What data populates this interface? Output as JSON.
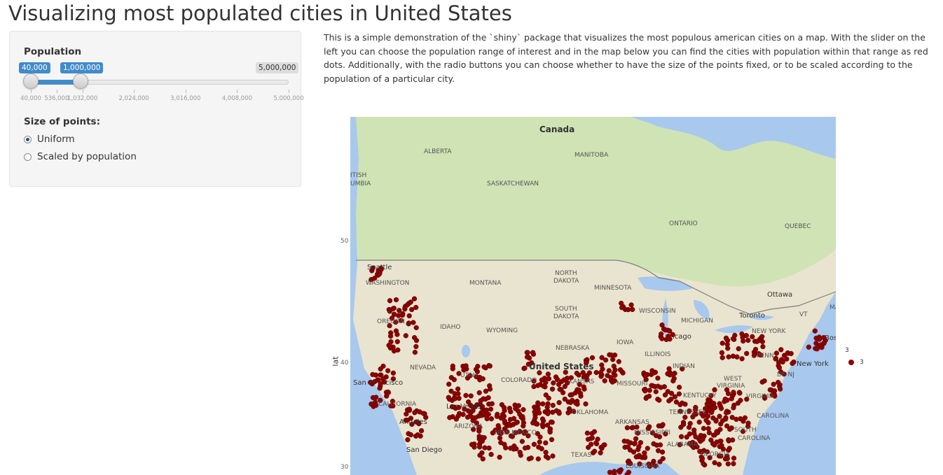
{
  "page": {
    "title": "Visualizing most populated cities in United States"
  },
  "sidebar": {
    "population_label": "Population",
    "slider": {
      "min_badge": "40,000",
      "high_badge": "1,000,000",
      "max_badge": "5,000,000",
      "selected_low": 40000,
      "selected_high": 1000000,
      "range_min": 40000,
      "range_max": 5000000,
      "ticks": [
        "40,000",
        "536,000",
        "1,032,000",
        "2,024,000",
        "3,016,000",
        "4,008,000",
        "5,000,000"
      ],
      "tick_values": [
        40000,
        536000,
        1032000,
        2024000,
        3016000,
        4008000,
        5000000
      ]
    },
    "size_label": "Size of points:",
    "radios": [
      {
        "label": "Uniform",
        "checked": true
      },
      {
        "label": "Scaled by population",
        "checked": false
      }
    ]
  },
  "description": "This is a simple demonstration of the `shiny` package that visualizes the most populous american cities on a map. With the slider on the left you can choose the population range of interest and in the map below you can find the cities with population within that range as red dots. Additionally, with the radio buttons you can choose whether to have the size of the points fixed, or to be scaled according to the population of a particular city.",
  "plot": {
    "y_axis_title": "lat",
    "y_ticks": [
      "50",
      "40",
      "30"
    ],
    "legend_title": "3",
    "legend_label": "3",
    "point_color": "#8b0000",
    "map_labels": {
      "canada": "Canada",
      "alberta": "ALBERTA",
      "manitoba": "MANITOBA",
      "british_columbia_1": "ITISH",
      "british_columbia_2": "UMBIA",
      "saskatchewan": "SASKATCHEWAN",
      "ontario": "ONTARIO",
      "quebec": "QUEBEC",
      "seattle": "Seattle",
      "washington": "WASHINGTON",
      "montana": "MONTANA",
      "north_dakota_1": "NORTH",
      "north_dakota_2": "DAKOTA",
      "minnesota": "MINNESOTA",
      "ottawa": "Ottawa",
      "south_dakota_1": "SOUTH",
      "south_dakota_2": "DAKOTA",
      "wisconsin": "WISCONSIN",
      "toronto": "Toronto",
      "oregon": "OREGON",
      "idaho": "IDAHO",
      "wyoming": "WYOMING",
      "michigan": "MICHIGAN",
      "new_york_state": "NEW YORK",
      "vt": "VT",
      "ma": "MA",
      "chicago": "icago",
      "iowa": "IOWA",
      "nebraska": "NEBRASKA",
      "boston": "Bos",
      "illinois": "ILLINOIS",
      "nevada": "NEVADA",
      "united_states": "United States",
      "new_york_city": "New York",
      "utah": "UTAH",
      "indiana": "INDIAN",
      "penn": "PENN",
      "colorado": "COLORADO",
      "kansas": "KANSAS",
      "missouri": "MISSOURI",
      "west_virginia": "WEST",
      "virginia": "VIRGINIA",
      "dc_nj": "DE NJ",
      "san_francisco": "San Fr",
      "san_francisco_2": "cisco",
      "california": "CALIFORNIA",
      "kentucky": "KENTUCKY",
      "virginia2": "VIRGINIA",
      "las_vegas": "Las Vegas",
      "oklahoma": "OKLAHOMA",
      "tennessee": "TENNESSEE",
      "north_carolina": "CAROLINA",
      "los_angeles": "Angeles",
      "arizona": "ARIZONA",
      "arkansas": "ARKANSAS",
      "south": "SOUTH",
      "new_mexico": "NEW MEXICO",
      "mississippi": "MISSISSIPPI",
      "south_carolina": "CAROLINA",
      "alabama": "ALABAMA",
      "san_diego": "San Diego",
      "georgia": "GEORGIA",
      "texas": "TEXAS",
      "louisiana": "LOUISIANA"
    }
  }
}
